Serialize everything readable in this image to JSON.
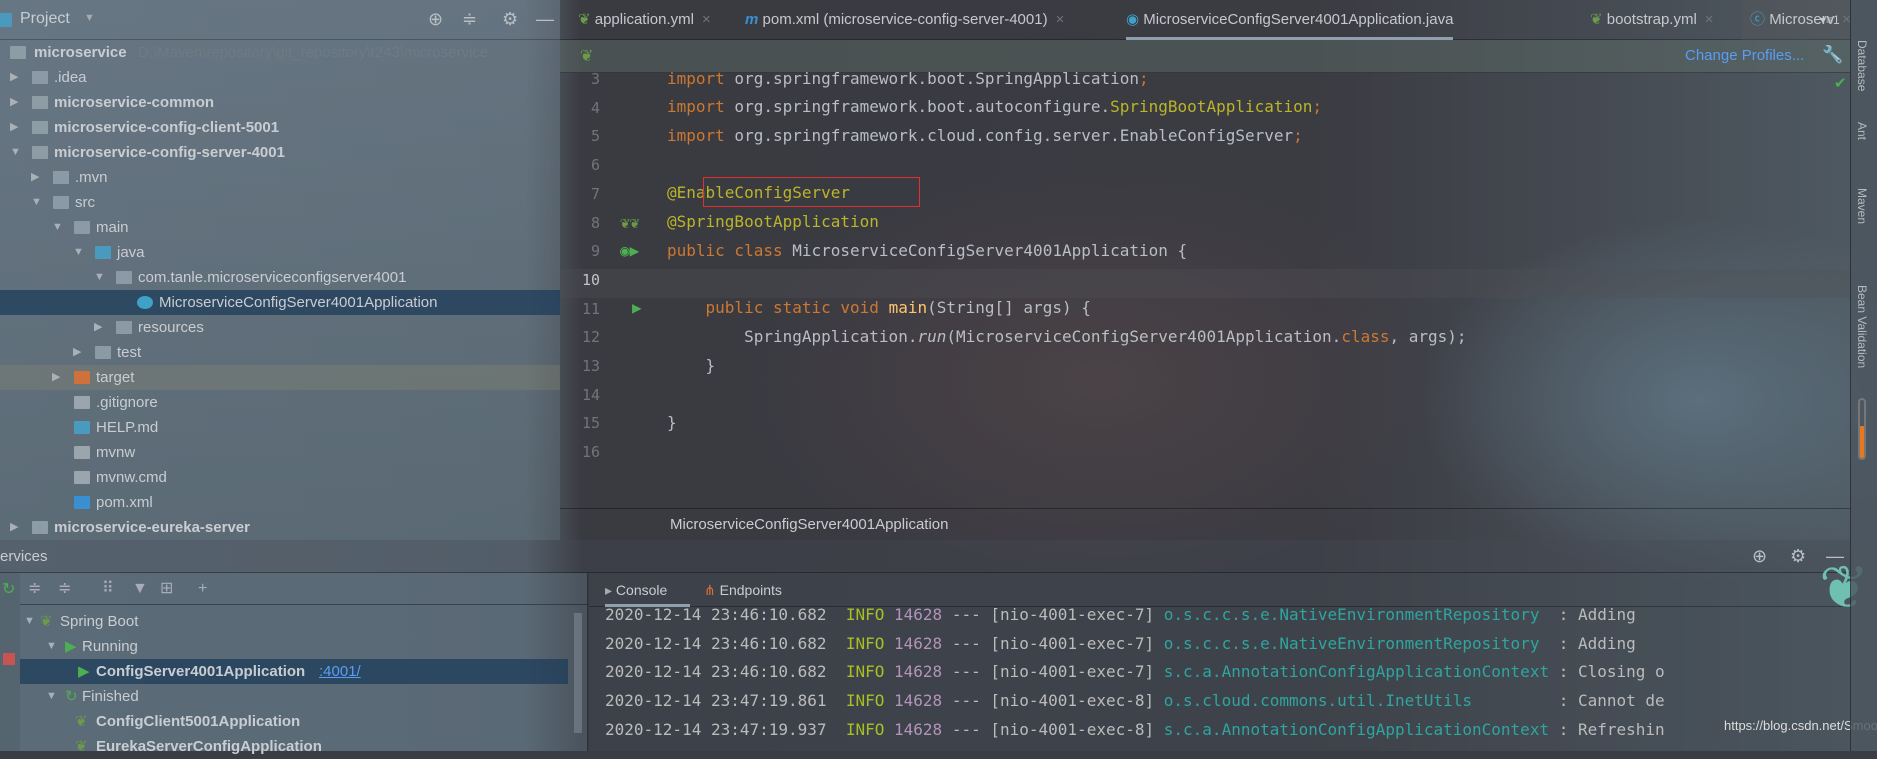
{
  "project": {
    "title": "Project",
    "root": "microservice",
    "root_path": "D:\\Maven\\repository\\git_repository\\t243\\microservice",
    "items": [
      ".idea",
      "microservice-common",
      "microservice-config-client-5001",
      "microservice-config-server-4001",
      ".mvn",
      "src",
      "main",
      "java",
      "com.tanle.microserviceconfigserver4001",
      "MicroserviceConfigServer4001Application",
      "resources",
      "test",
      "target",
      ".gitignore",
      "HELP.md",
      "mvnw",
      "mvnw.cmd",
      "pom.xml",
      "microservice-eureka-server"
    ]
  },
  "tabs": [
    {
      "label": "application.yml"
    },
    {
      "label": "pom.xml (microservice-config-server-4001)"
    },
    {
      "label": "MicroserviceConfigServer4001Application.java",
      "active": true
    },
    {
      "label": "bootstrap.yml"
    },
    {
      "label": "Microserv"
    }
  ],
  "tab_overflow": "1",
  "editor": {
    "change_profiles": "Change Profiles...",
    "line_numbers": [
      "3",
      "4",
      "5",
      "6",
      "7",
      "8",
      "9",
      "10",
      "11",
      "12",
      "13",
      "14",
      "15",
      "16"
    ],
    "code": {
      "l3a": "import",
      "l3b": " org.springframework.boot.SpringApplication",
      "l3c": ";",
      "l4a": "import",
      "l4b": " org.springframework.boot.autoconfigure.",
      "l4c": "SpringBootApplication",
      "l4d": ";",
      "l5a": "import",
      "l5b": " org.springframework.cloud.config.server.EnableConfigServer",
      "l5c": ";",
      "l7": "@EnableConfigServer",
      "l8": "@SpringBootApplication",
      "l9a": "public class ",
      "l9b": "MicroserviceConfigServer4001Application {",
      "l11a": "    public static void ",
      "l11b": "main",
      "l11c": "(String[] args) {",
      "l12a": "        SpringApplication.",
      "l12b": "run",
      "l12c": "(MicroserviceConfigServer4001Application.",
      "l12d": "class",
      "l12e": ", args);",
      "l13": "    }",
      "l15": "}"
    },
    "breadcrumb": "MicroserviceConfigServer4001Application",
    "highlight_color": "#e03030"
  },
  "services": {
    "title": "ervices",
    "tree": [
      {
        "label": "Spring Boot"
      },
      {
        "label": "Running"
      },
      {
        "label": "ConfigServer4001Application",
        "link": ":4001/"
      },
      {
        "label": "Finished"
      },
      {
        "label": "ConfigClient5001Application"
      },
      {
        "label": "EurekaServerConfigApplication"
      }
    ],
    "console_tabs": [
      "Console",
      "Endpoints"
    ],
    "logs": [
      {
        "ts": "2020-12-14 23:46:10.682",
        "level": "INFO",
        "pid": "14628",
        "sep": "---",
        "thread": "[nio-4001-exec-7]",
        "logger": "o.s.c.c.s.e.NativeEnvironmentRepository ",
        "msg": " : Adding"
      },
      {
        "ts": "2020-12-14 23:46:10.682",
        "level": "INFO",
        "pid": "14628",
        "sep": "---",
        "thread": "[nio-4001-exec-7]",
        "logger": "o.s.c.c.s.e.NativeEnvironmentRepository ",
        "msg": " : Adding"
      },
      {
        "ts": "2020-12-14 23:46:10.682",
        "level": "INFO",
        "pid": "14628",
        "sep": "---",
        "thread": "[nio-4001-exec-7]",
        "logger": "s.c.a.AnnotationConfigApplicationContext",
        "msg": " : Closing o"
      },
      {
        "ts": "2020-12-14 23:47:19.861",
        "level": "INFO",
        "pid": "14628",
        "sep": "---",
        "thread": "[nio-4001-exec-8]",
        "logger": "o.s.cloud.commons.util.InetUtils        ",
        "msg": " : Cannot de"
      },
      {
        "ts": "2020-12-14 23:47:19.937",
        "level": "INFO",
        "pid": "14628",
        "sep": "---",
        "thread": "[nio-4001-exec-8]",
        "logger": "s.c.a.AnnotationConfigApplicationContext",
        "msg": " : Refreshin"
      }
    ]
  },
  "watermark": "https://blog.csdn.net/Smootht",
  "right_strip": [
    "Database",
    "Ant",
    "Maven",
    "Bean Validation"
  ]
}
